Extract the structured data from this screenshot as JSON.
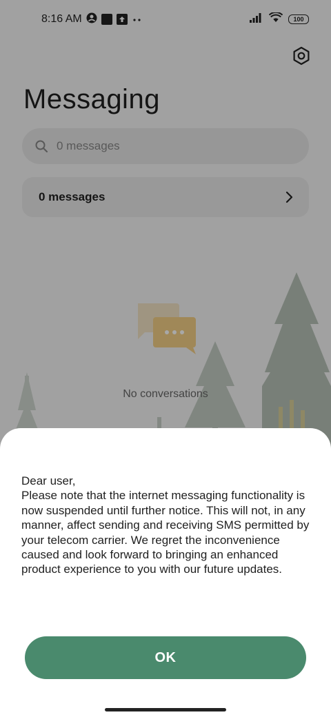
{
  "status_bar": {
    "time": "8:16 AM",
    "battery": "100",
    "icons": [
      "account-circle-icon",
      "square-notification-icon",
      "upload-notification-icon",
      "more-dots-icon",
      "signal-icon",
      "wifi-icon",
      "battery-icon"
    ]
  },
  "header": {
    "title": "Messaging",
    "settings_icon": "settings-hexagon-icon"
  },
  "search": {
    "placeholder": "0 messages",
    "icon": "search-icon"
  },
  "folder": {
    "label": "0 messages",
    "icon": "chevron-right-icon"
  },
  "empty_state": {
    "text": "No conversations",
    "icon": "chat-bubbles-icon"
  },
  "dialog": {
    "message": "Dear user,\nPlease note that the internet messaging functionality is now suspended until further notice. This will not, in any manner, affect sending and receiving SMS permitted by your telecom carrier. We regret the inconvenience caused and look forward to bringing an enhanced product experience to you with our future updates.",
    "ok_label": "OK"
  },
  "colors": {
    "accent": "#4a8a6d",
    "scrim": "rgba(0,0,0,0.34)",
    "sheet": "#ffffff"
  }
}
